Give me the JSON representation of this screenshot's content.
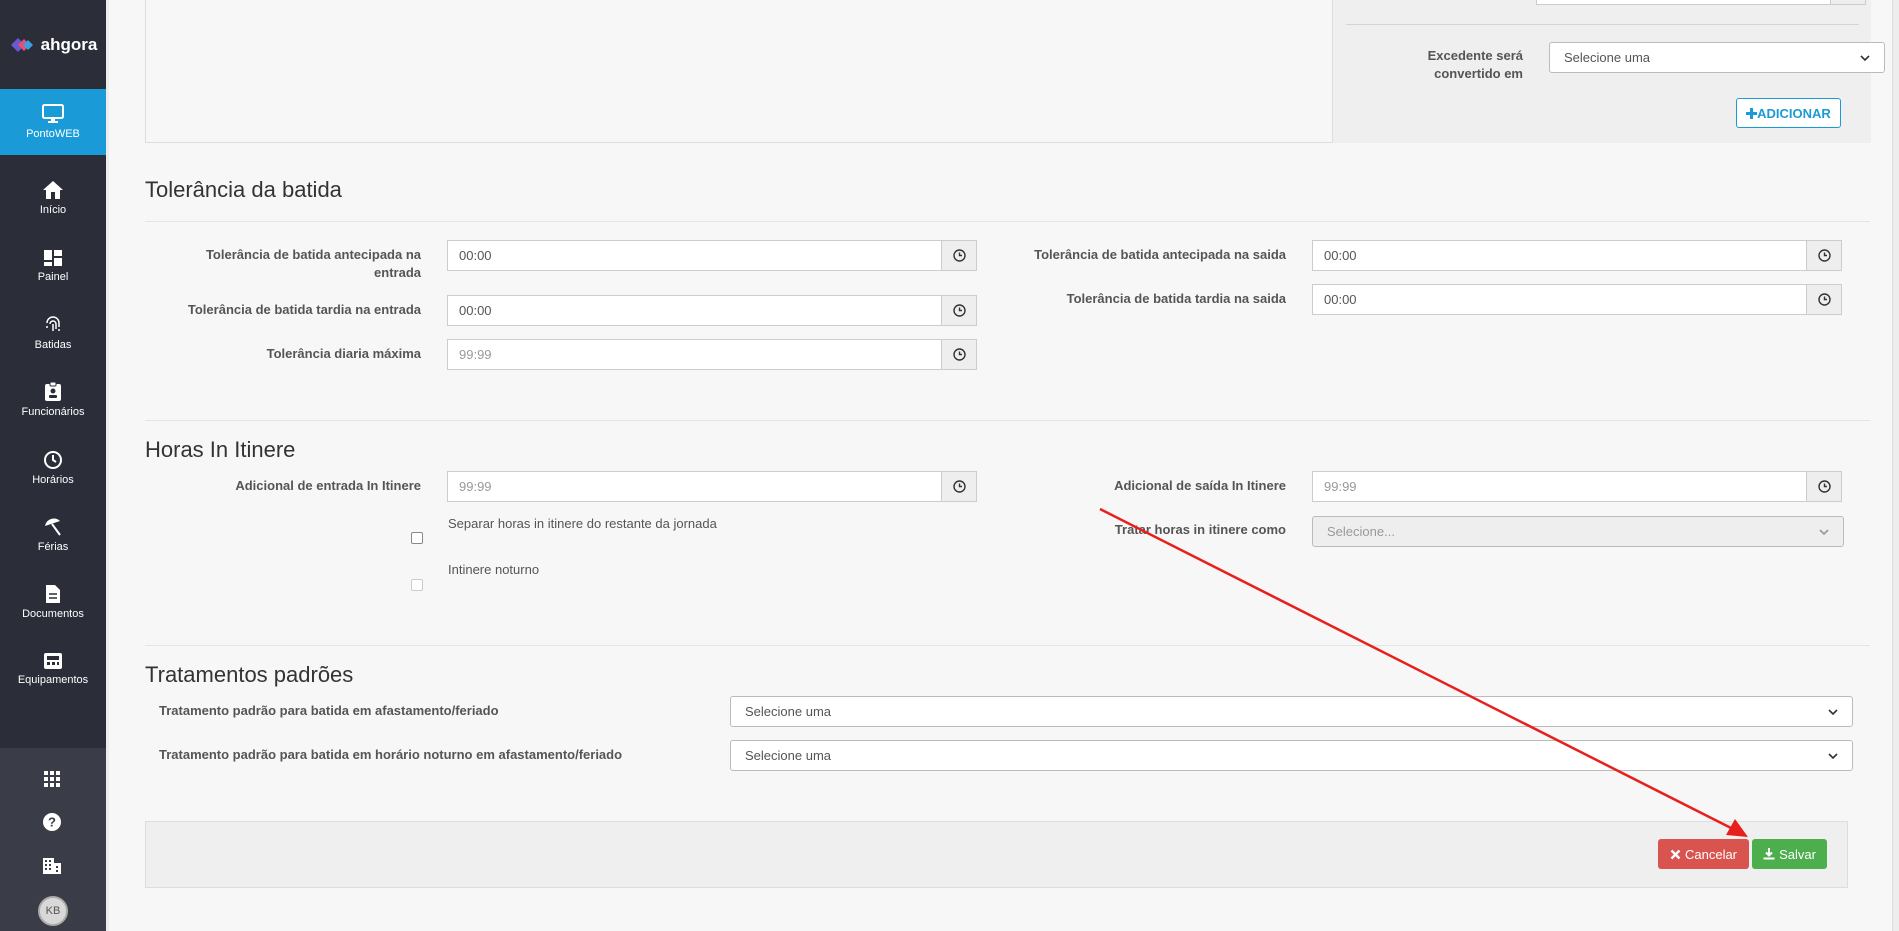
{
  "sidebar": {
    "logo": "ahgora",
    "items": [
      {
        "label": "PontoWEB",
        "icon": "monitor-icon"
      },
      {
        "label": "Início",
        "icon": "home-icon"
      },
      {
        "label": "Painel",
        "icon": "dashboard-icon"
      },
      {
        "label": "Batidas",
        "icon": "fingerprint-icon"
      },
      {
        "label": "Funcionários",
        "icon": "badge-icon"
      },
      {
        "label": "Horários",
        "icon": "clock-icon"
      },
      {
        "label": "Férias",
        "icon": "beach-umbrella-icon"
      },
      {
        "label": "Documentos",
        "icon": "document-icon"
      },
      {
        "label": "Equipamentos",
        "icon": "equipment-icon"
      }
    ],
    "bottom_icons": [
      "apps-grid-icon",
      "help-icon",
      "building-icon"
    ],
    "avatar": "KB"
  },
  "top": {
    "excedente_label_1": "Excedente será",
    "excedente_label_2": "convertido em",
    "excedente_value": "Selecione uma",
    "add_button": "ADICIONAR"
  },
  "tolerancia": {
    "title": "Tolerância da batida",
    "antecipada_entrada_label_1": "Tolerância de batida antecipada na",
    "antecipada_entrada_label_2": "entrada",
    "antecipada_entrada_value": "00:00",
    "tardia_entrada_label": "Tolerância de batida tardia na entrada",
    "tardia_entrada_value": "00:00",
    "diaria_label": "Tolerância diaria máxima",
    "diaria_placeholder": "99:99",
    "antecipada_saida_label": "Tolerância de batida antecipada na saida",
    "antecipada_saida_value": "00:00",
    "tardia_saida_label": "Tolerância de batida tardia na saida",
    "tardia_saida_value": "00:00"
  },
  "itinere": {
    "title": "Horas In Itinere",
    "entrada_label": "Adicional de entrada In Itinere",
    "entrada_placeholder": "99:99",
    "saida_label": "Adicional de saída In Itinere",
    "saida_placeholder": "99:99",
    "separar_label": "Separar horas in itinere do restante da jornada",
    "noturno_label": "Intinere noturno",
    "tratar_label": "Tratar horas in itinere como",
    "tratar_value": "Selecione..."
  },
  "tratamentos": {
    "title": "Tratamentos padrões",
    "afastamento_label": "Tratamento padrão para batida em afastamento/feriado",
    "afastamento_value": "Selecione uma",
    "noturno_label": "Tratamento padrão para batida em horário noturno em afastamento/feriado",
    "noturno_value": "Selecione uma"
  },
  "actions": {
    "cancel": "Cancelar",
    "save": "Salvar"
  },
  "colors": {
    "sidebar_bg": "#2b2d38",
    "active": "#1a9bd7",
    "cancel": "#d9534f",
    "save": "#4cae4c",
    "annotation_arrow": "#e8201d"
  }
}
